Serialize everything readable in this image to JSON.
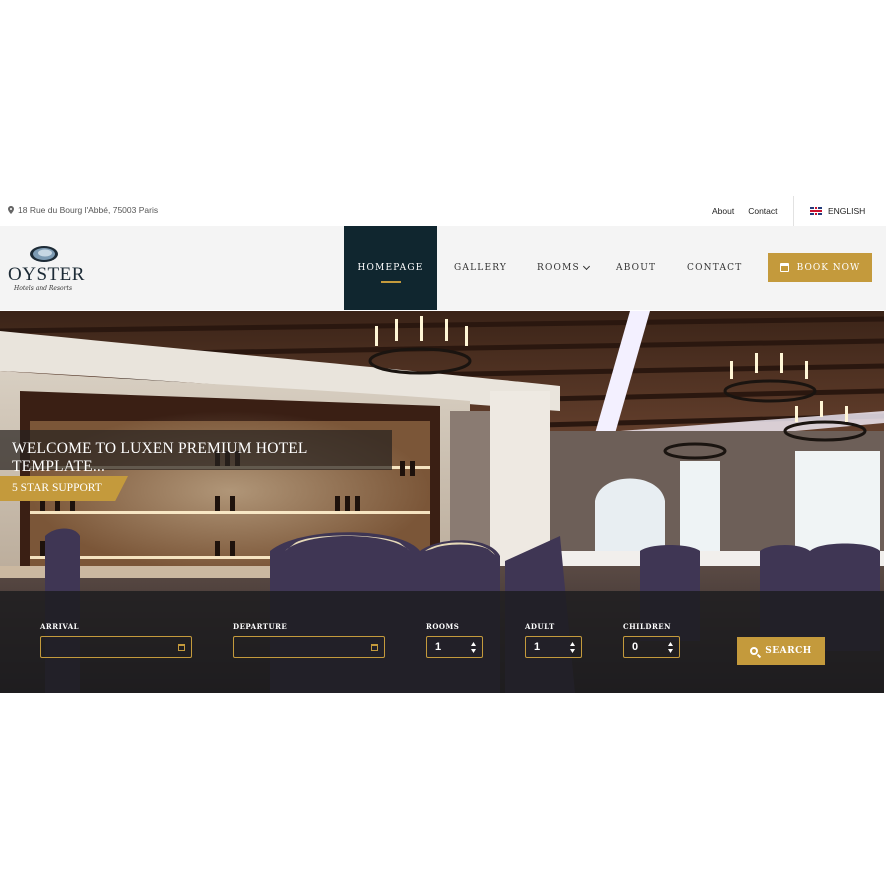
{
  "topbar": {
    "address": "18 Rue du Bourg l'Abbé, 75003 Paris",
    "links": [
      "About",
      "Contact"
    ],
    "language": "ENGLISH"
  },
  "logo": {
    "name": "OYSTER",
    "tagline": "Hotels and Resorts"
  },
  "nav": {
    "items": [
      "HOMEPAGE",
      "GALLERY",
      "ROOMS",
      "ABOUT",
      "CONTACT"
    ],
    "active": "HOMEPAGE",
    "book_label": "BOOK NOW"
  },
  "hero": {
    "welcome": "WELCOME TO LUXEN PREMIUM HOTEL TEMPLATE...",
    "support": "5 STAR SUPPORT"
  },
  "booking": {
    "arrival_label": "ARRIVAL",
    "arrival_value": "",
    "departure_label": "DEPARTURE",
    "departure_value": "",
    "rooms_label": "ROOMS",
    "rooms_value": "1",
    "adult_label": "ADULT",
    "adult_value": "1",
    "children_label": "CHILDREN",
    "children_value": "0",
    "search_label": "SEARCH"
  },
  "colors": {
    "accent_gold": "#c49a3c",
    "nav_active_bg": "#10262f",
    "navbar_bg": "#f4f4f4"
  }
}
